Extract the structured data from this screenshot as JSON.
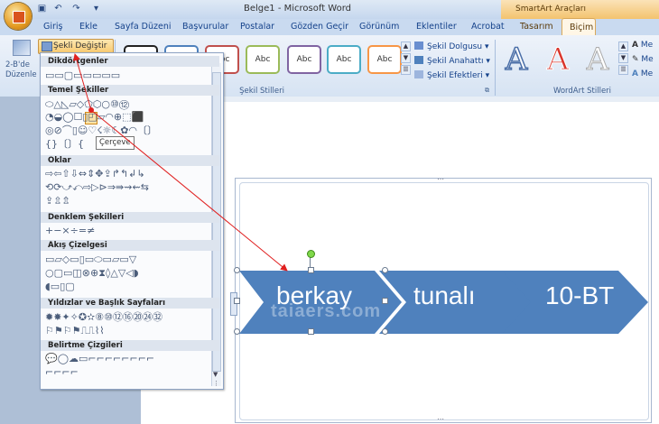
{
  "window": {
    "title": "Belge1 - Microsoft Word",
    "context_tab_group": "SmartArt Araçları",
    "quick_access": [
      "save-icon",
      "undo-icon",
      "redo-icon",
      "customize-icon"
    ]
  },
  "tabs": [
    "Giriş",
    "Ekle",
    "Sayfa Düzeni",
    "Başvurular",
    "Postalar",
    "Gözden Geçir",
    "Görünüm",
    "Eklentiler",
    "Acrobat",
    "Tasarım",
    "Biçim"
  ],
  "active_tab": "Biçim",
  "ribbon": {
    "twod_button_label": "2-B'de Düzenle",
    "change_shape_label": "Şekli Değiştir",
    "style_sample_text": "Abc",
    "shape_styles_group": "Şekil Stilleri",
    "shape_fill": "Şekil Dolgusu",
    "shape_outline": "Şekil Anahattı",
    "shape_effects": "Şekil Efektleri",
    "wordart_styles_group": "WordArt Stilleri",
    "wordart_letter": "A",
    "wordart_trunc": "Me",
    "style_colors": [
      "#4f81bd",
      "#c0504d",
      "#9bbb59",
      "#8064a2",
      "#4bacc6",
      "#f79646"
    ]
  },
  "dropdown": {
    "sections": [
      {
        "title": "Dikdörtgenler",
        "rows": [
          "▭▭▢▭▭▭▭▭"
        ]
      },
      {
        "title": "Temel Şekiller",
        "rows": [
          "⬭△◺▱◇⬠⬡○⑩⑫",
          "◔◒◯☐▯◰▱◠⊕⬚⬛",
          "◎⊘⌒▯☺♡☇☼☾✿◠〔〕",
          "{}〔〕{"
        ]
      },
      {
        "title": "Oklar",
        "rows": [
          "⇨⇦⇧⇩⇔⇕✥⇪↱↰↲↳",
          "⟲⟳⤻⤺⇨▷⊳⇒⇛⇝⇜⇆",
          "⇪⇫⇬"
        ]
      },
      {
        "title": "Denklem Şekilleri",
        "rows": [
          "+−×÷=≠"
        ]
      },
      {
        "title": "Akış Çizelgesi",
        "rows": [
          "▭▱◇▭▯▭⬭▭▱▭▽",
          "○▢▭◫⊗⊕⧗◊△▽◁◗",
          "◖▭▯▢"
        ]
      },
      {
        "title": "Yıldızlar ve Başlık Sayfaları",
        "rows": [
          "✹✸✦✧✪✫⑧⑩⑫⑯⑳㉔㉜",
          "⚐⚑⚐⚑⎍⎍⌇⌇"
        ]
      },
      {
        "title": "Belirtme Çizgileri",
        "rows": [
          "💬◯☁▭⌐⌐⌐⌐⌐⌐⌐⌐",
          "⌐⌐⌐⌐"
        ]
      }
    ],
    "tooltip": "Çerçeve"
  },
  "smartart": {
    "items": [
      "berkay",
      "tunalı",
      "10-BT"
    ],
    "fill_color": "#4f81bd",
    "watermark": "taiaers.com"
  }
}
